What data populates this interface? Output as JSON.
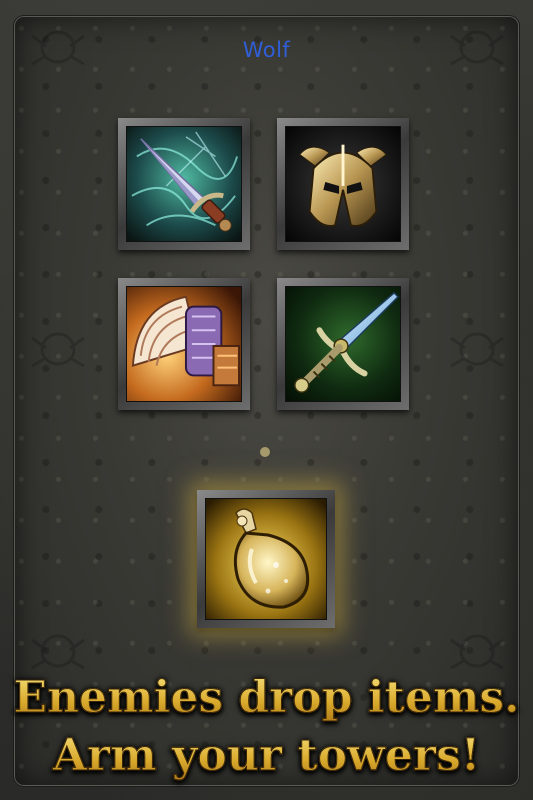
{
  "screen": {
    "title": "Wolf",
    "caption_line1": "Enemies drop items.",
    "caption_line2": "Arm your towers!"
  },
  "items": [
    {
      "name": "enchanted-dagger-icon",
      "interactable": true
    },
    {
      "name": "golden-helmet-icon",
      "interactable": true
    },
    {
      "name": "battle-axe-icon",
      "interactable": true
    },
    {
      "name": "ornate-sword-icon",
      "interactable": true
    }
  ],
  "featured_item": {
    "name": "golden-potion-icon"
  },
  "colors": {
    "title": "#2f5ed6",
    "caption_gold": "#e8c94a",
    "potion_glow": "#c8aa46"
  }
}
